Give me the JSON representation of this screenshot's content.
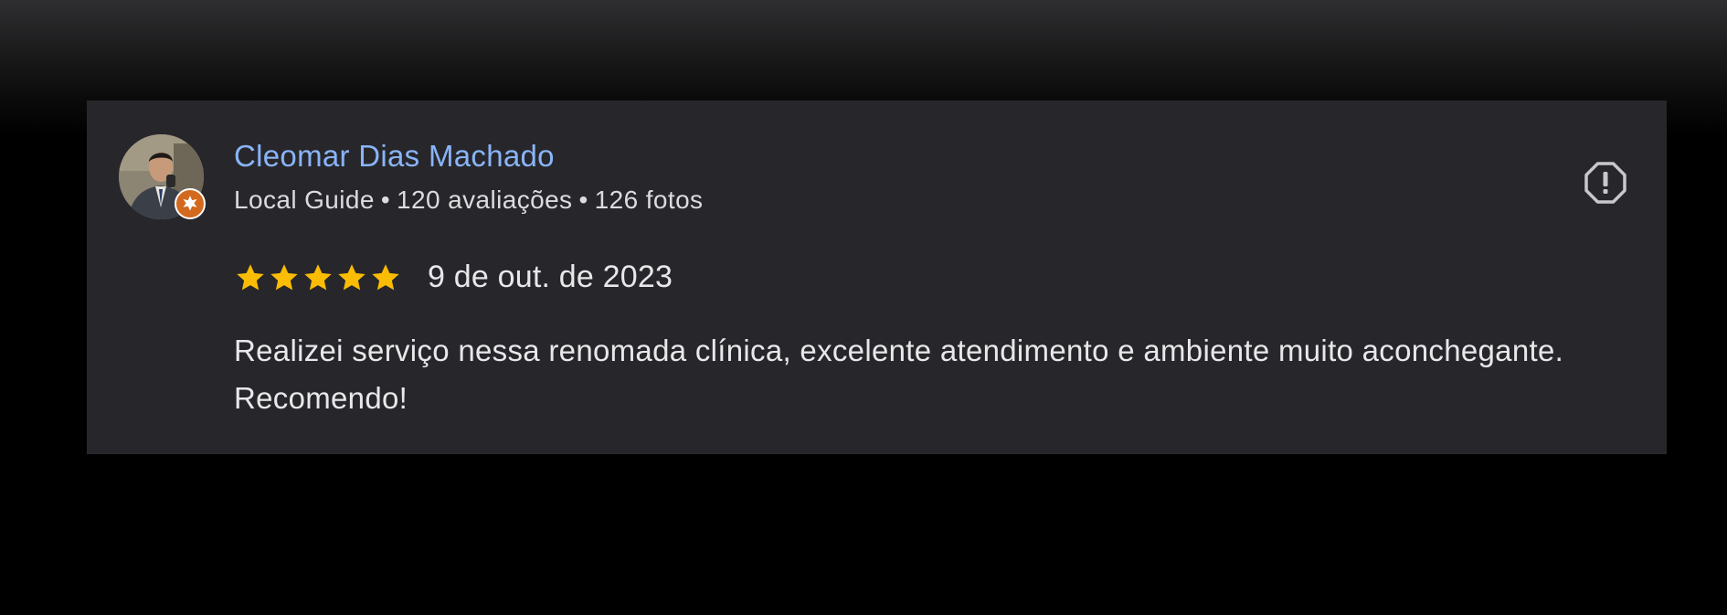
{
  "review": {
    "reviewer": {
      "name": "Cleomar Dias Machado",
      "badge": "Local Guide",
      "reviews_count": "120 avaliações",
      "photos_count": "126 fotos",
      "separator": "•",
      "avatar_icon": "avatar-photo",
      "badge_icon": "local-guide-star-icon",
      "badge_color": "#d2691e"
    },
    "rating": {
      "value": 5,
      "max": 5,
      "star_color": "#fbbc04"
    },
    "date": "9 de out. de 2023",
    "text": "Realizei serviço nessa renomada clínica, excelente atendimento e ambiente muito aconchegante. Recomendo!",
    "report_icon": "report-icon"
  },
  "colors": {
    "card_background": "#27272b",
    "name_link": "#8ab4f8",
    "text": "#e8e8ea"
  }
}
